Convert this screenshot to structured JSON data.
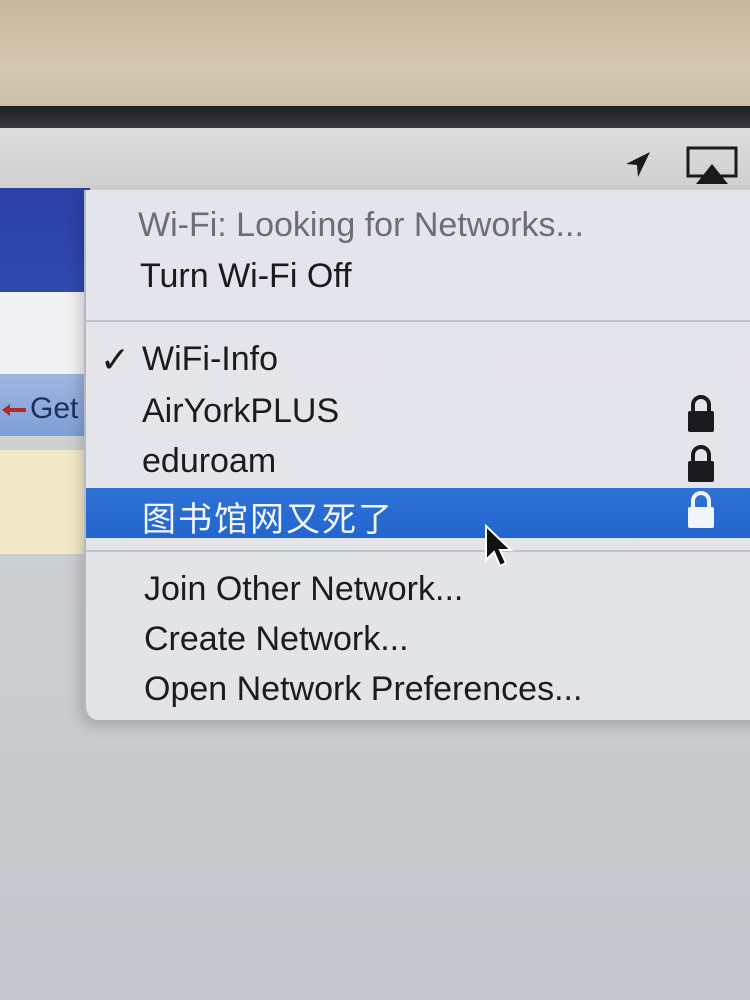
{
  "menubar": {
    "icons": [
      "location-arrow-icon",
      "airplay-icon"
    ]
  },
  "background_window": {
    "button_label": "Get",
    "colors": {
      "header": "#2b3fa8",
      "button": "#8fa9dc",
      "row": "#f2e8c8"
    }
  },
  "wifi_menu": {
    "status": "Wi-Fi: Looking for Networks...",
    "toggle_label": "Turn Wi-Fi Off",
    "networks": [
      {
        "name": "WiFi-Info",
        "connected": true,
        "secured": false
      },
      {
        "name": "AirYorkPLUS",
        "connected": false,
        "secured": true
      },
      {
        "name": "eduroam",
        "connected": false,
        "secured": true
      },
      {
        "name": "图书馆网又死了",
        "connected": false,
        "secured": true,
        "highlighted": true
      }
    ],
    "actions": [
      {
        "label": "Join Other Network..."
      },
      {
        "label": "Create Network..."
      },
      {
        "label": "Open Network Preferences..."
      }
    ],
    "colors": {
      "highlight": "#2a6dd4",
      "text": "#1b1b1d",
      "disabled_text": "#6d6d74"
    }
  }
}
